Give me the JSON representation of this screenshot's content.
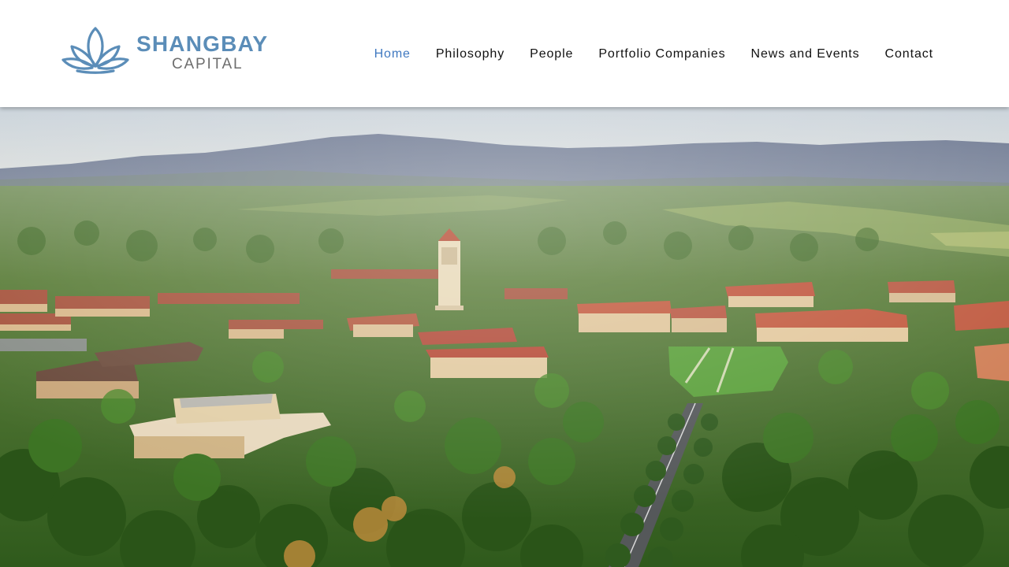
{
  "logo": {
    "name": "SHANGBAY",
    "subtitle": "CAPITAL",
    "icon": "lotus-icon",
    "brand_color": "#5b8db8",
    "subtitle_color": "#6e6e6e"
  },
  "nav": {
    "items": [
      {
        "label": "Home",
        "active": true
      },
      {
        "label": "Philosophy",
        "active": false
      },
      {
        "label": "People",
        "active": false
      },
      {
        "label": "Portfolio Companies",
        "active": false
      },
      {
        "label": "News and Events",
        "active": false
      },
      {
        "label": "Contact",
        "active": false
      }
    ],
    "active_color": "#3f78c0",
    "text_color": "#111111"
  },
  "hero": {
    "image": "aerial-campus-photo"
  }
}
